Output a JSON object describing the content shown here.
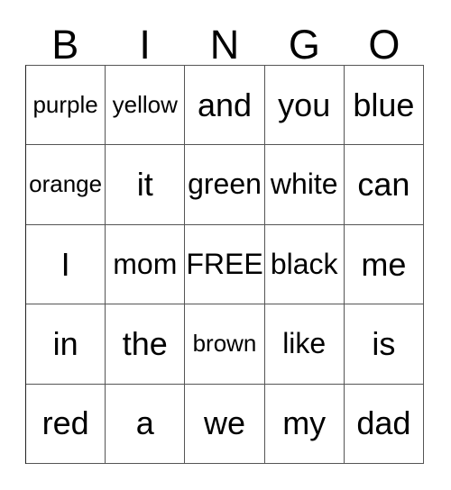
{
  "card": {
    "title": "BINGO",
    "header": {
      "letters": [
        "B",
        "I",
        "N",
        "G",
        "O"
      ]
    },
    "grid": {
      "columns": 5,
      "rows": 5,
      "free_space_label": "FREE",
      "cells": [
        [
          {
            "text": "purple",
            "size": "sm",
            "free": false
          },
          {
            "text": "yellow",
            "size": "sm",
            "free": false
          },
          {
            "text": "and",
            "size": "lg",
            "free": false
          },
          {
            "text": "you",
            "size": "lg",
            "free": false
          },
          {
            "text": "blue",
            "size": "lg",
            "free": false
          }
        ],
        [
          {
            "text": "orange",
            "size": "sm",
            "free": false
          },
          {
            "text": "it",
            "size": "lg",
            "free": false
          },
          {
            "text": "green",
            "size": "md",
            "free": false
          },
          {
            "text": "white",
            "size": "md",
            "free": false
          },
          {
            "text": "can",
            "size": "lg",
            "free": false
          }
        ],
        [
          {
            "text": "I",
            "size": "lg",
            "free": false
          },
          {
            "text": "mom",
            "size": "md",
            "free": false
          },
          {
            "text": "FREE",
            "size": "md",
            "free": true
          },
          {
            "text": "black",
            "size": "md",
            "free": false
          },
          {
            "text": "me",
            "size": "lg",
            "free": false
          }
        ],
        [
          {
            "text": "in",
            "size": "lg",
            "free": false
          },
          {
            "text": "the",
            "size": "lg",
            "free": false
          },
          {
            "text": "brown",
            "size": "sm",
            "free": false
          },
          {
            "text": "like",
            "size": "md",
            "free": false
          },
          {
            "text": "is",
            "size": "lg",
            "free": false
          }
        ],
        [
          {
            "text": "red",
            "size": "lg",
            "free": false
          },
          {
            "text": "a",
            "size": "lg",
            "free": false
          },
          {
            "text": "we",
            "size": "lg",
            "free": false
          },
          {
            "text": "my",
            "size": "lg",
            "free": false
          },
          {
            "text": "dad",
            "size": "lg",
            "free": false
          }
        ]
      ]
    },
    "colors": {
      "background": "#ffffff",
      "text": "#000000",
      "grid_line": "#555555"
    }
  }
}
